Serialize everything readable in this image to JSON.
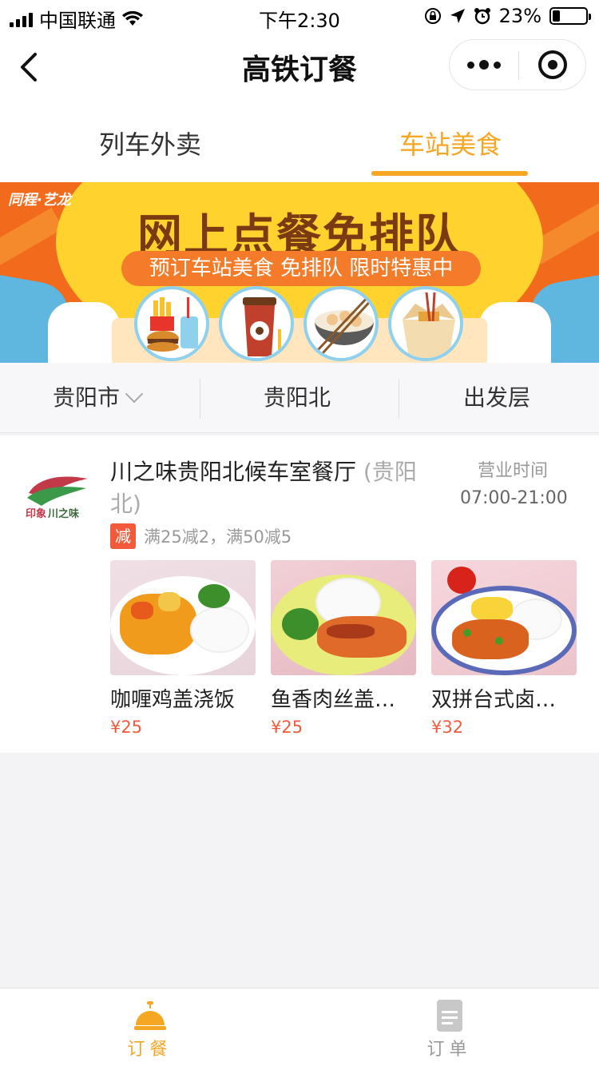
{
  "status_bar": {
    "carrier": "中国联通",
    "time": "下午2:30",
    "battery": "23%",
    "battery_level": 0.23,
    "icons": [
      "signal-icon",
      "wifi-icon",
      "orientation-lock-icon",
      "location-icon",
      "alarm-icon",
      "battery-icon"
    ]
  },
  "navbar": {
    "title": "高铁订餐",
    "back_icon": "chevron-left-icon",
    "more_icon": "more-dots-icon",
    "close_icon": "target-close-icon"
  },
  "tabs": [
    {
      "label": "列车外卖",
      "active": false
    },
    {
      "label": "车站美食",
      "active": true
    }
  ],
  "accent_color": "#f5a623",
  "price_color": "#f15b3c",
  "banner": {
    "brand": "同程·艺龙",
    "headline": "网上点餐免排队",
    "subline": "预订车站美食 免排队 限时特惠中",
    "icons": [
      "burger-fries-icon",
      "coffee-cup-icon",
      "bowl-chopsticks-icon",
      "noodle-box-icon"
    ]
  },
  "filters": {
    "city": "贵阳市",
    "station": "贵阳北",
    "floor": "出发层"
  },
  "restaurant": {
    "logo_text": "印象川之味",
    "name": "川之味贵阳北候车室餐厅",
    "location": "(贵阳北)",
    "hours_label": "营业时间",
    "hours": "07:00-21:00",
    "promo_tag": "减",
    "promo_text": "满25减2，满50减5",
    "dishes": [
      {
        "name": "咖喱鸡盖浇饭",
        "price": "¥25"
      },
      {
        "name": "鱼香肉丝盖…",
        "price": "¥25"
      },
      {
        "name": "双拼台式卤…",
        "price": "¥32"
      }
    ]
  },
  "tabbar": [
    {
      "label": "订餐",
      "icon": "service-bell-icon",
      "active": true
    },
    {
      "label": "订单",
      "icon": "order-list-icon",
      "active": false
    }
  ]
}
